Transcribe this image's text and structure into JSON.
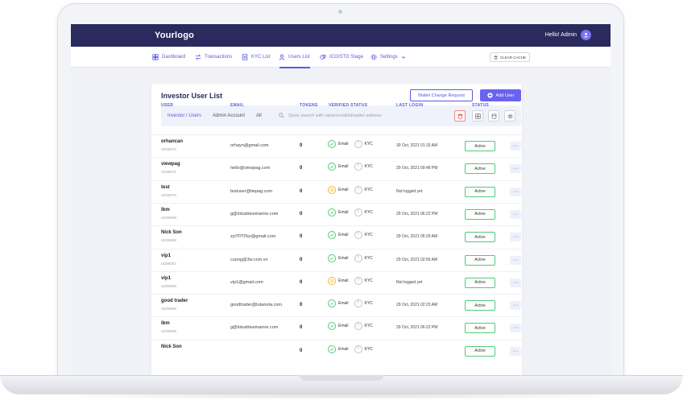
{
  "app": {
    "logo": "Yourlogo",
    "greeting": "Hello! Admin"
  },
  "nav": {
    "items": [
      {
        "label": "Dashboard",
        "icon": "dashboard-icon"
      },
      {
        "label": "Transactions",
        "icon": "transactions-icon"
      },
      {
        "label": "KYC List",
        "icon": "kyc-list-icon"
      },
      {
        "label": "Users List",
        "icon": "users-icon"
      },
      {
        "label": "ICO/STO Stage",
        "icon": "stage-icon"
      },
      {
        "label": "Settings",
        "icon": "gear-icon"
      }
    ],
    "active": "Users List",
    "clear_cache": "CLEAR CACHE"
  },
  "page": {
    "title": "Investor User List",
    "wallet_button": "Wallet Change Request",
    "add_button": "Add User"
  },
  "filters": {
    "tabs": [
      "Investor / Users",
      "Admin Account",
      "All"
    ],
    "search_placeholder": "Quick search with name/email/id/wallet address"
  },
  "table": {
    "headers": {
      "user": "USER",
      "email": "EMAIL",
      "tokens": "TOKENS",
      "verified": "VERIFIED STATUS",
      "last_login": "LAST LOGIN",
      "status": "STATUS"
    },
    "email_label": "Email",
    "kyc_label": "KYC",
    "rows": [
      {
        "name": "orhancan",
        "id": "UD08072",
        "email": "orhayn@gmail.com",
        "tokens": "0",
        "email_state": "ok",
        "last_login": "30 Oct, 2021 01:33 AM",
        "status": "Active"
      },
      {
        "name": "viewpag",
        "id": "UD08071",
        "email": "hello@viewpag.com",
        "tokens": "0",
        "email_state": "ok",
        "last_login": "29 Oct, 2021 09:48 PM",
        "status": "Active"
      },
      {
        "name": "test",
        "id": "UD08070",
        "email": "testuser@tiepag.com",
        "tokens": "0",
        "email_state": "warn",
        "last_login": "Not logged yet",
        "status": "Active"
      },
      {
        "name": "lbm",
        "id": "UD08069",
        "email": "g@lotusbluemarine.com",
        "tokens": "0",
        "email_state": "ok",
        "last_login": "29 Oct, 2021 06:22 PM",
        "status": "Active"
      },
      {
        "name": "Nick Son",
        "id": "UD08068",
        "email": "zyl7f7f7lsz@gmail.com",
        "tokens": "0",
        "email_state": "ok",
        "last_login": "29 Oct, 2021 05:29 AM",
        "status": "Active"
      },
      {
        "name": "vip1",
        "id": "UD08067",
        "email": "cuong@3w.com.vn",
        "tokens": "0",
        "email_state": "ok",
        "last_login": "29 Oct, 2021 02:55 AM",
        "status": "Active"
      },
      {
        "name": "vip1",
        "id": "UD08066",
        "email": "vip1@gmail.com",
        "tokens": "0",
        "email_state": "warn",
        "last_login": "Not logged yet",
        "status": "Active"
      },
      {
        "name": "good trader",
        "id": "UD08065",
        "email": "goodtrader@tutanota.com",
        "tokens": "0",
        "email_state": "ok",
        "last_login": "29 Oct, 2021 02:23 AM",
        "status": "Active"
      },
      {
        "name": "lbm",
        "id": "UD08069",
        "email": "g@lotusbluemarine.com",
        "tokens": "0",
        "email_state": "ok",
        "last_login": "29 Oct, 2021 06:22 PM",
        "status": "Active"
      },
      {
        "name": "Nick Son",
        "id": "",
        "email": "",
        "tokens": "0",
        "email_state": "ok",
        "last_login": "",
        "status": "Active"
      }
    ]
  },
  "colors": {
    "topbar": "#2a2a5e",
    "accent": "#5b57e6",
    "success": "#52c97a",
    "warning": "#f2b531"
  }
}
